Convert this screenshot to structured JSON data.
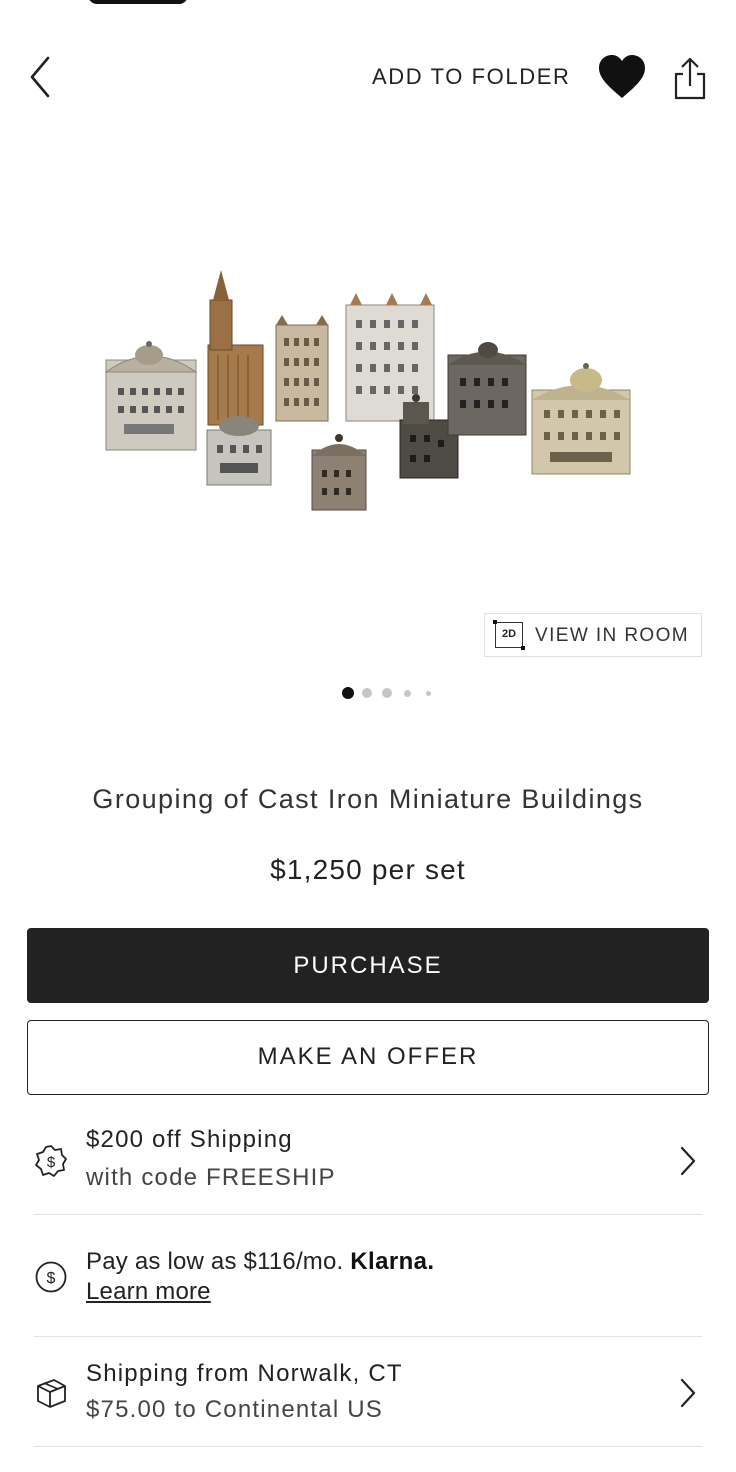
{
  "header": {
    "add_to_folder": "ADD TO FOLDER"
  },
  "view_in_room": {
    "badge": "2D",
    "label": "VIEW IN ROOM"
  },
  "carousel": {
    "count": 5,
    "active": 1
  },
  "product": {
    "title": "Grouping of Cast Iron Miniature Buildings",
    "price": "$1,250 per set"
  },
  "actions": {
    "purchase": "PURCHASE",
    "offer": "MAKE AN OFFER"
  },
  "promo": {
    "line1": "$200 off Shipping",
    "line2": "with code FREESHIP"
  },
  "financing": {
    "text": "Pay as low as $116/mo.",
    "brand": "Klarna.",
    "link": "Learn more"
  },
  "shipping": {
    "line1": "Shipping from Norwalk, CT",
    "line2": "$75.00 to Continental US"
  },
  "colors": {
    "primary_button": "#222222",
    "text": "#222222",
    "divider": "#e2e2e2"
  },
  "icons": {
    "back": "chevron-left-icon",
    "favorite": "heart-icon",
    "share": "share-icon",
    "promo": "dollar-badge-icon",
    "financing": "dollar-circle-icon",
    "shipping": "box-icon",
    "chevron": "chevron-right-icon"
  }
}
